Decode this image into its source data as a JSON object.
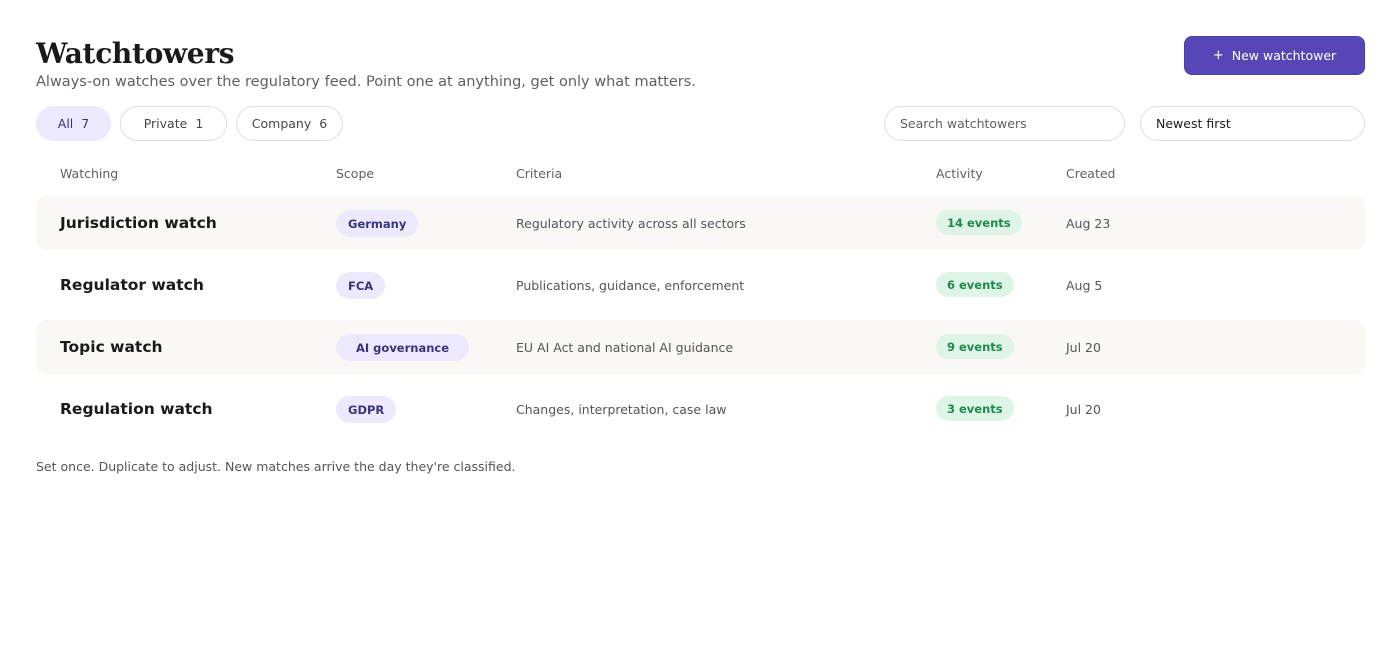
{
  "header": {
    "title": "Watchtowers",
    "subtitle": "Always-on watches over the regulatory feed. Point one at anything, get only what matters.",
    "new_button_icon": "+",
    "new_button_label": "New watchtower"
  },
  "filters": [
    {
      "label": "All",
      "count": "7",
      "active": true
    },
    {
      "label": "Private",
      "count": "1",
      "active": false
    },
    {
      "label": "Company",
      "count": "6",
      "active": false
    }
  ],
  "search": {
    "placeholder": "Search watchtowers",
    "value": ""
  },
  "sort": {
    "value": "Newest first"
  },
  "table": {
    "columns": [
      "Watching",
      "Scope",
      "Criteria",
      "Activity",
      "Created"
    ],
    "rows": [
      {
        "name": "Jurisdiction watch",
        "scope": "Germany",
        "criteria": "Regulatory activity across all sectors",
        "activity": "14 events",
        "created": "Aug 23"
      },
      {
        "name": "Regulator watch",
        "scope": "FCA",
        "criteria": "Publications, guidance, enforcement",
        "activity": "6 events",
        "created": "Aug 5"
      },
      {
        "name": "Topic watch",
        "scope": "AI governance",
        "criteria": "EU AI Act and national AI guidance",
        "activity": "9 events",
        "created": "Jul 20"
      },
      {
        "name": "Regulation watch",
        "scope": "GDPR",
        "criteria": "Changes, interpretation, case law",
        "activity": "3 events",
        "created": "Jul 20"
      }
    ]
  },
  "footnote": "Set once. Duplicate to adjust. New matches arrive the day they're classified.",
  "colors": {
    "accent": "#5548b6",
    "chip_active_bg": "#ebe9fb",
    "activity_bg": "#def4e6",
    "activity_text": "#1e8a4c"
  }
}
